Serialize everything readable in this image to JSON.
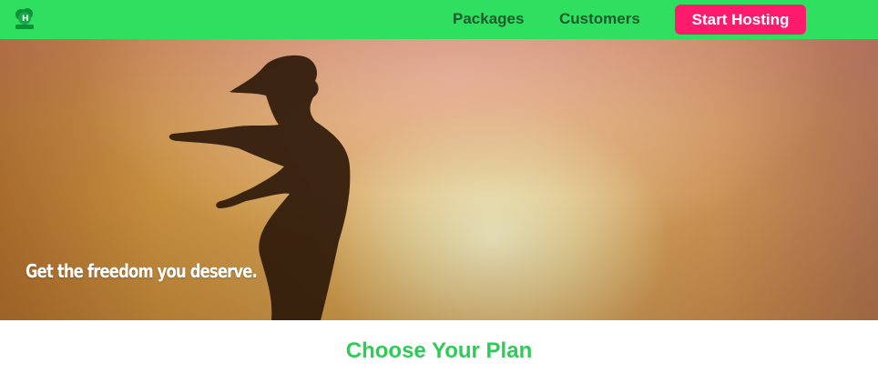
{
  "nav": {
    "logo_icon": "leaf-logo-icon",
    "links": [
      {
        "label": "Packages"
      },
      {
        "label": "Customers"
      }
    ],
    "cta_label": "Start Hosting"
  },
  "hero": {
    "tagline": "Get the freedom you deserve."
  },
  "plans": {
    "title": "Choose Your Plan"
  },
  "colors": {
    "nav_bg": "#2fe060",
    "cta_bg": "#ff1a6c",
    "title_green": "#2ecc56"
  }
}
